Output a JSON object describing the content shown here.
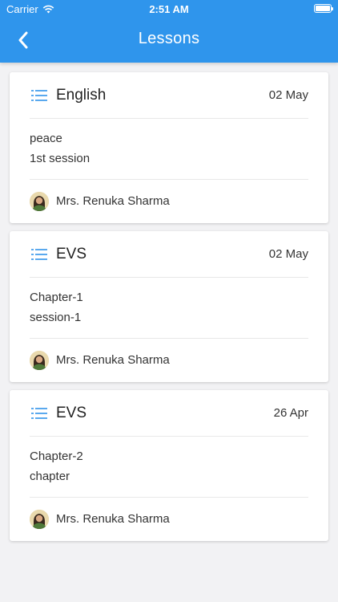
{
  "status_bar": {
    "carrier": "Carrier",
    "time": "2:51 AM"
  },
  "nav": {
    "title": "Lessons",
    "back_icon": "chevron-left-icon"
  },
  "colors": {
    "header_bg": "#2f95ec",
    "list_icon": "#5aa9ee",
    "page_bg": "#f2f2f4"
  },
  "lessons": [
    {
      "subject": "English",
      "date": "02 May",
      "line1": "peace",
      "line2": "1st session",
      "teacher": "Mrs. Renuka Sharma"
    },
    {
      "subject": "EVS",
      "date": "02 May",
      "line1": "Chapter-1",
      "line2": "session-1",
      "teacher": "Mrs. Renuka Sharma"
    },
    {
      "subject": "EVS",
      "date": "26 Apr",
      "line1": "Chapter-2",
      "line2": "chapter",
      "teacher": "Mrs. Renuka Sharma"
    }
  ]
}
